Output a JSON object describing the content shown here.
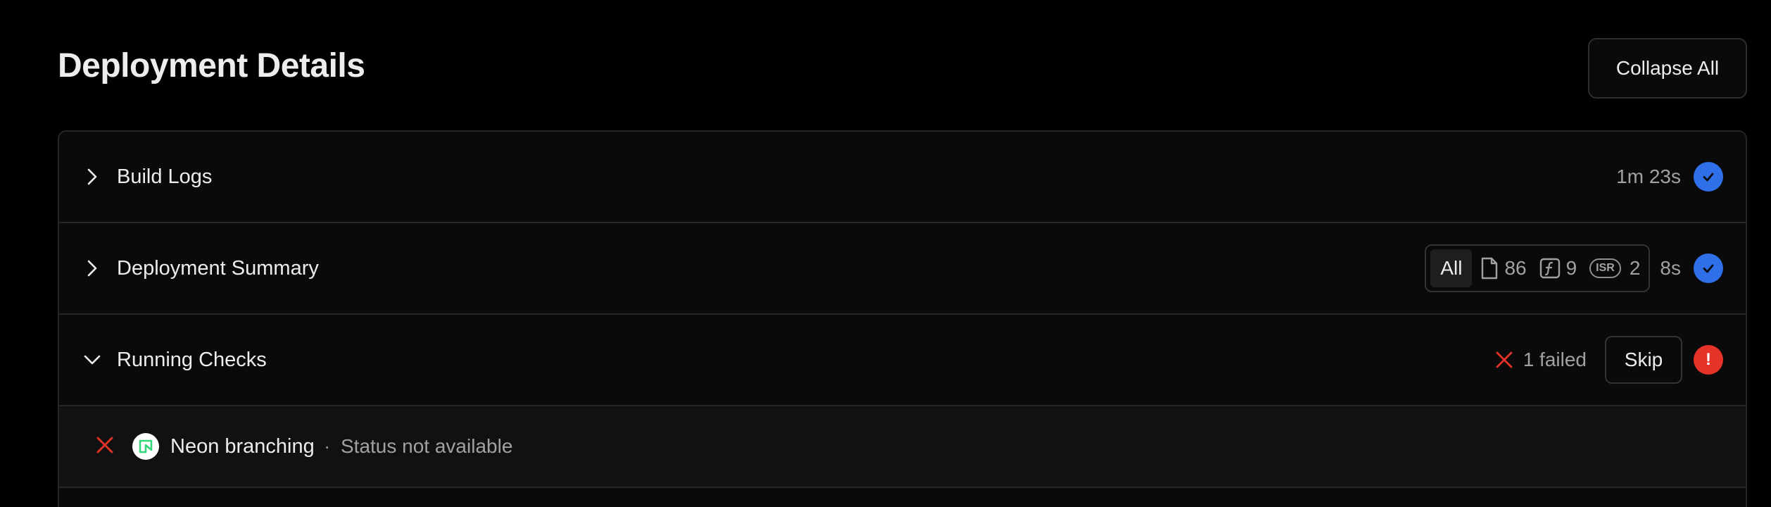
{
  "header": {
    "title": "Deployment Details",
    "collapse_label": "Collapse All"
  },
  "sections": [
    {
      "title": "Build Logs",
      "duration": "1m 23s",
      "status": "success",
      "expanded": false
    },
    {
      "title": "Deployment Summary",
      "duration": "8s",
      "status": "success",
      "expanded": false,
      "filter": {
        "all_label": "All",
        "static_count": "86",
        "function_count": "9",
        "isr_badge": "ISR",
        "isr_count": "2"
      }
    },
    {
      "title": "Running Checks",
      "status": "error",
      "expanded": true,
      "failed_text": "1 failed",
      "skip_label": "Skip",
      "error_glyph": "!",
      "checks": [
        {
          "name": "Neon branching",
          "separator": "·",
          "status_text": "Status not available",
          "result": "failed"
        }
      ]
    }
  ],
  "colors": {
    "success": "#2f6fe8",
    "error": "#e5332a",
    "neon_accent": "#35d67c"
  },
  "icons": {
    "chevron_collapsed": "chevron-right-icon",
    "chevron_expanded": "chevron-down-icon",
    "success": "check-circle-icon",
    "error": "alert-circle-icon",
    "fail": "x-icon",
    "static": "file-icon",
    "function": "function-icon",
    "neon": "neon-logo-icon"
  }
}
